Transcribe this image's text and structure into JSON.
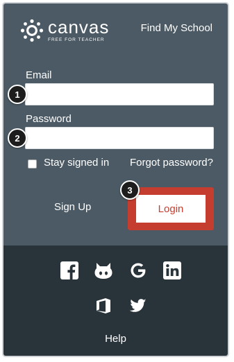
{
  "header": {
    "brand_name": "canvas",
    "brand_tagline": "FREE FOR TEACHER",
    "find_school_label": "Find My School"
  },
  "form": {
    "email_label": "Email",
    "email_value": "",
    "password_label": "Password",
    "password_value": "",
    "stay_signed_in_label": "Stay signed in",
    "stay_signed_in_checked": false,
    "forgot_password_label": "Forgot password?"
  },
  "actions": {
    "signup_label": "Sign Up",
    "login_label": "Login"
  },
  "callouts": {
    "email": "1",
    "password": "2",
    "login": "3"
  },
  "social": {
    "icons": [
      "facebook-icon",
      "github-icon",
      "google-icon",
      "linkedin-icon",
      "office365-icon",
      "twitter-icon"
    ]
  },
  "footer": {
    "help_label": "Help"
  },
  "colors": {
    "panel_top": "#4b5a64",
    "panel_bottom": "#29333a",
    "login_accent": "#c43d2f"
  }
}
